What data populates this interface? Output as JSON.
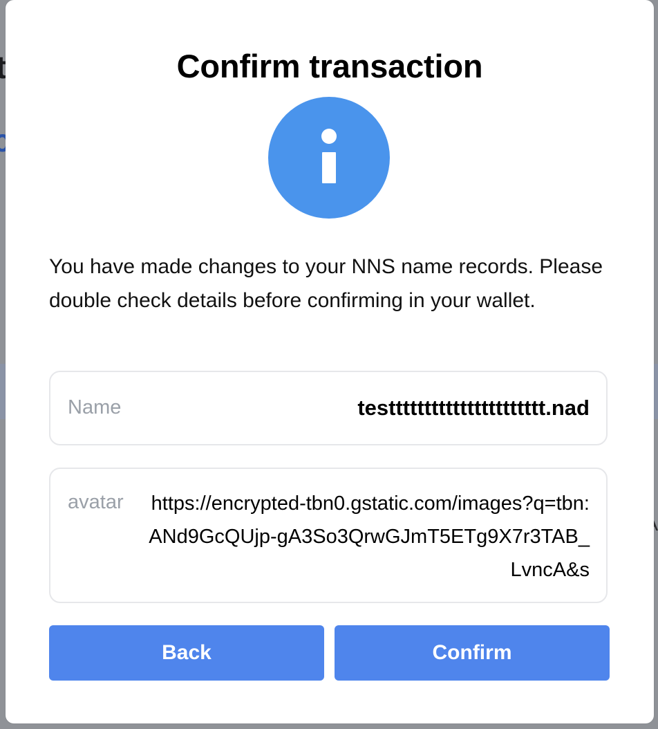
{
  "background": {
    "title_fragment": "t",
    "link_fragment": "c",
    "row_fragment": "A"
  },
  "modal": {
    "title": "Confirm transaction",
    "icon": "info-icon",
    "message": "You have made changes to your NNS name records. Please double check details before confirming in your wallet.",
    "records": [
      {
        "label": "Name",
        "value": "testttttttttttttttttttttt.nad"
      },
      {
        "label": "avatar",
        "value": "https://encrypted-tbn0.gstatic.com/images?q=tbn:ANd9GcQUjp-gA3So3QrwGJmT5ETg9X7r3TAB_LvncA&s"
      }
    ],
    "back_label": "Back",
    "confirm_label": "Confirm"
  },
  "colors": {
    "accent": "#4f85ec",
    "info": "#4a94ec",
    "overlay": "#8f9297"
  }
}
